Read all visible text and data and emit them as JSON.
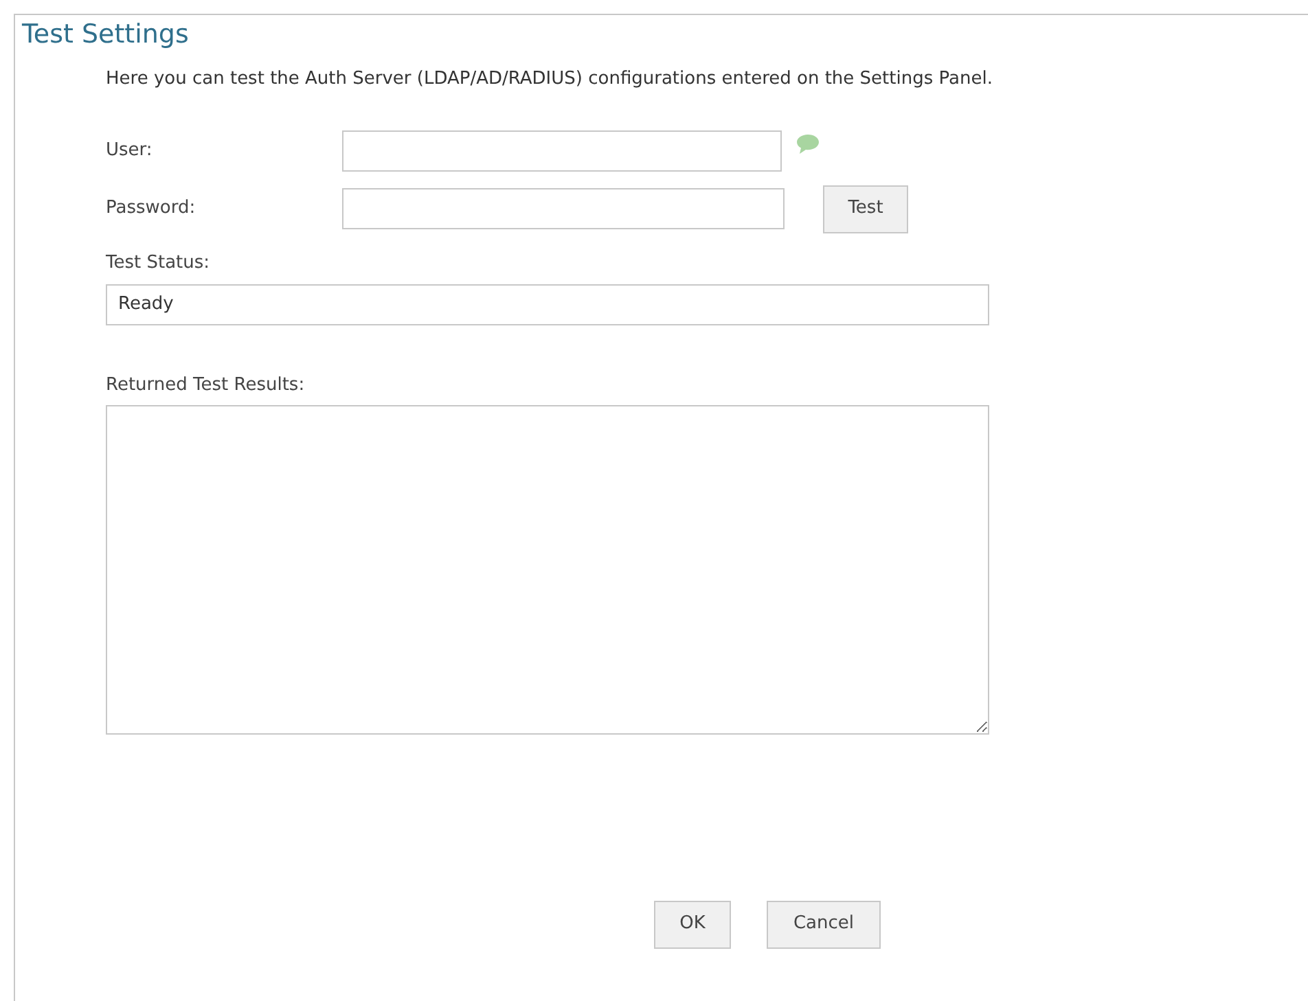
{
  "window": {
    "title": "Test Settings"
  },
  "description": "Here you can test the Auth Server (LDAP/AD/RADIUS) configurations entered on the Settings Panel.",
  "user": {
    "label": "User:"
  },
  "password": {
    "label": "Password:"
  },
  "test_button": "Test",
  "test_status": {
    "label": "Test Status:",
    "value": "Ready"
  },
  "results": {
    "label": "Returned Test Results:"
  },
  "buttons": [
    "OK",
    "Cancel"
  ]
}
